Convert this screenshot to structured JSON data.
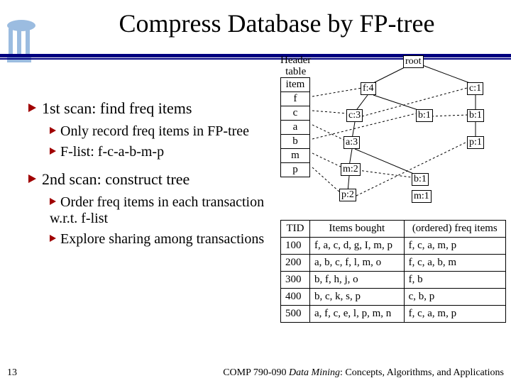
{
  "title": "Compress Database by FP-tree",
  "page_number": "13",
  "footer_course": "COMP 790-090 ",
  "footer_em": "Data Mining",
  "footer_rest": ": Concepts, Algorithms, and Applications",
  "bullets": {
    "b1a": "1st scan: find freq items",
    "b2a": "Only record freq items in FP-tree",
    "b2b": "F-list: f-c-a-b-m-p",
    "b1b": "2nd scan: construct tree",
    "b2c": "Order freq items in each transaction w.r.t. f-list",
    "b2d": "Explore sharing among transactions"
  },
  "header_table": {
    "title1": "Header",
    "title2": "table",
    "col": "item",
    "rows": [
      "f",
      "c",
      "a",
      "b",
      "m",
      "p"
    ]
  },
  "tree": {
    "root": "root",
    "f4": "f:4",
    "c3": "c:3",
    "a3": "a:3",
    "m2": "m:2",
    "p2": "p:2",
    "b1a": "b:1",
    "b1b": "b:1",
    "m1": "m:1",
    "c1": "c:1",
    "b1c": "b:1",
    "p1": "p:1"
  },
  "table": {
    "h1": "TID",
    "h2": "Items bought",
    "h3": "(ordered) freq items",
    "rows": [
      {
        "tid": "100",
        "items": "f, a, c, d, g, I, m, p",
        "ord": "f, c, a, m, p"
      },
      {
        "tid": "200",
        "items": "a, b, c, f, l, m, o",
        "ord": "f, c, a, b, m"
      },
      {
        "tid": "300",
        "items": "b, f, h, j, o",
        "ord": "f, b"
      },
      {
        "tid": "400",
        "items": "b, c, k, s, p",
        "ord": "c, b, p"
      },
      {
        "tid": "500",
        "items": "a, f, c, e, l, p, m, n",
        "ord": "f, c, a, m, p"
      }
    ]
  }
}
